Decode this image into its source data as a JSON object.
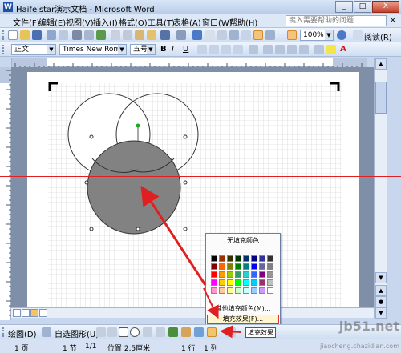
{
  "window": {
    "title": "Haifeistar演示文档 - Microsoft Word",
    "controls": [
      "_",
      "□",
      "X"
    ]
  },
  "menu": {
    "items": [
      "文件(F)",
      "编辑(E)",
      "视图(V)",
      "插入(I)",
      "格式(O)",
      "工具(T)",
      "表格(A)",
      "窗口(W)",
      "帮助(H)"
    ],
    "help_placeholder": "键入需要帮助的问题",
    "close": "×"
  },
  "toolbar": {
    "zoom": "100%",
    "read_label": "阅读(R)"
  },
  "format_bar": {
    "style": "正文",
    "font": "Times New Roman",
    "size": "五号",
    "bold": "B",
    "italic": "I",
    "underline": "U",
    "font_color_label": "A"
  },
  "fill_menu": {
    "no_fill": "无填充颜色",
    "more_colors": "其他填充颜色(M)...",
    "fill_effects": "填充效果(F)...",
    "colors": [
      "#000000",
      "#993300",
      "#333300",
      "#003300",
      "#003366",
      "#000080",
      "#333399",
      "#333333",
      "#800000",
      "#ff6600",
      "#808000",
      "#008000",
      "#008080",
      "#0000ff",
      "#666699",
      "#808080",
      "#ff0000",
      "#ff9900",
      "#99cc00",
      "#339966",
      "#33cccc",
      "#3366ff",
      "#800080",
      "#969696",
      "#ff00ff",
      "#ffcc00",
      "#ffff00",
      "#00ff00",
      "#00ffff",
      "#00ccff",
      "#993366",
      "#c0c0c0",
      "#ff99cc",
      "#ffcc99",
      "#ffff99",
      "#ccffcc",
      "#ccffff",
      "#99ccff",
      "#cc99ff",
      "#ffffff"
    ]
  },
  "drawing_bar": {
    "draw": "绘图(D)",
    "autoshapes": "自选图形(U)",
    "tooltip": "填充效果"
  },
  "status_bar": {
    "page": "1 页",
    "section": "1 节",
    "pages": "1/1",
    "position": "位置 2.5厘米",
    "line": "1 行",
    "col": "1 列"
  },
  "watermark": {
    "brand": "jb51.net",
    "site": "jiaocheng.chazidian.com"
  },
  "colors": {
    "shape_fill": "#828282",
    "annotation": "#e02020"
  }
}
